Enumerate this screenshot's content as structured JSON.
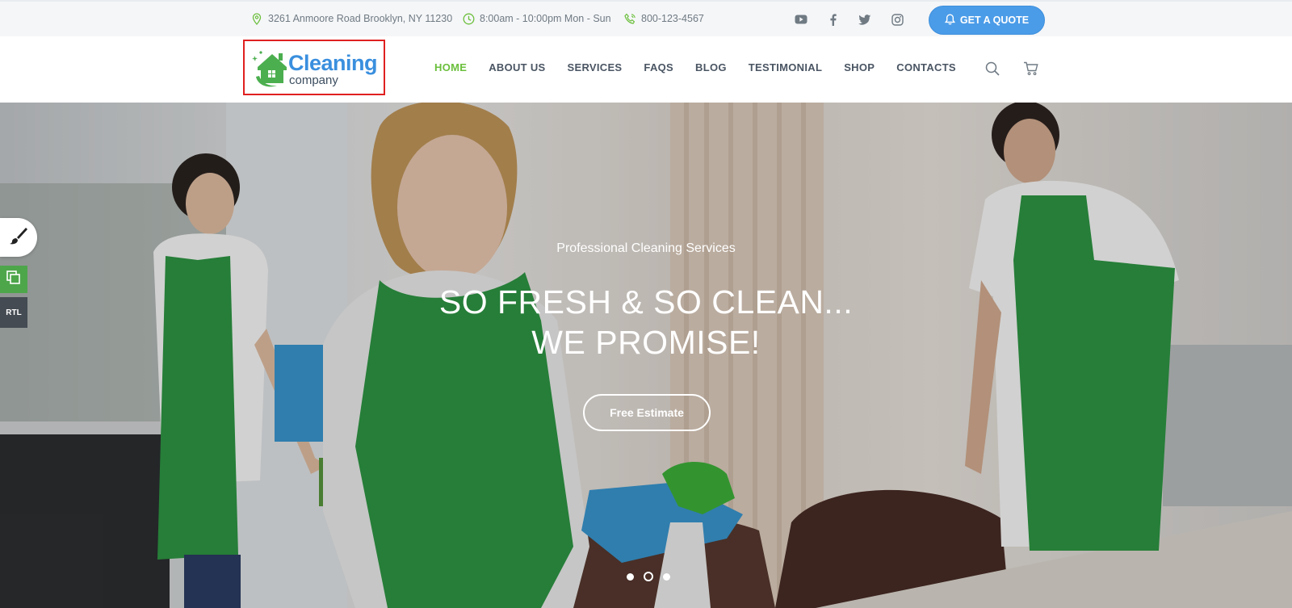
{
  "topbar": {
    "address": "3261 Anmoore Road Brooklyn, NY 11230",
    "hours": "8:00am - 10:00pm Mon - Sun",
    "phone": "800-123-4567",
    "quote_label": "GET A QUOTE",
    "social": [
      "youtube-icon",
      "facebook-icon",
      "twitter-icon",
      "instagram-icon"
    ]
  },
  "logo": {
    "line1": "Cleaning",
    "line2": "company"
  },
  "nav": {
    "items": [
      {
        "label": "HOME",
        "active": true
      },
      {
        "label": "ABOUT US"
      },
      {
        "label": "SERVICES"
      },
      {
        "label": "FAQS"
      },
      {
        "label": "BLOG"
      },
      {
        "label": "TESTIMONIAL"
      },
      {
        "label": "SHOP"
      },
      {
        "label": "CONTACTS"
      }
    ]
  },
  "hero": {
    "subtitle": "Professional Cleaning Services",
    "title_line1": "SO FRESH & SO CLEAN...",
    "title_line2": "WE PROMISE!",
    "button_label": "Free Estimate",
    "slides": 3,
    "active_slide": 2
  },
  "side_tools": {
    "rtl_label": "RTL"
  },
  "colors": {
    "accent_green": "#6bbf3c",
    "quote_blue": "#4b9ce8",
    "logo_blue": "#3a8fde",
    "nav_text": "#4a5563",
    "apron_green": "#2f9a45"
  }
}
